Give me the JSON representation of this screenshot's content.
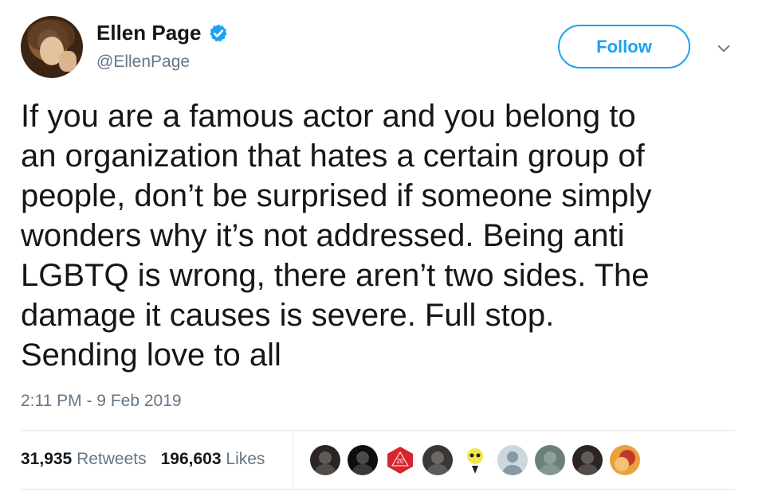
{
  "author": {
    "name": "Ellen Page",
    "handle": "@EllenPage",
    "verified": true
  },
  "actions": {
    "follow_label": "Follow"
  },
  "tweet": {
    "text": "If you are a famous actor and you belong to\nan organization that hates a certain group of\npeople, don’t be surprised if someone simply\nwonders why it’s not addressed. Being anti\nLGBTQ is wrong, there aren’t two sides. The\ndamage it causes is severe. Full stop.\nSending love to all",
    "timestamp": "2:11 PM - 9 Feb 2019"
  },
  "stats": {
    "retweets_count": "31,935",
    "retweets_label": "Retweets",
    "likes_count": "196,603",
    "likes_label": "Likes"
  },
  "likers": [
    {
      "icon": "avatar-woman-dark-hair",
      "color": "#2b2422"
    },
    {
      "icon": "avatar-dark-portrait",
      "color": "#0e0e0e"
    },
    {
      "icon": "avatar-red-d20-die",
      "color": "#d7262b",
      "label": "20"
    },
    {
      "icon": "avatar-night-scene",
      "color": "#3a3735"
    },
    {
      "icon": "avatar-cartoon-yellow",
      "color": "#f2e64b"
    },
    {
      "icon": "avatar-default-silhouette",
      "color": "#ccd6dd"
    },
    {
      "icon": "avatar-group-photo",
      "color": "#6a7f7a"
    },
    {
      "icon": "avatar-woman-portrait",
      "color": "#2d2523"
    },
    {
      "icon": "avatar-orange-portrait",
      "color": "#e9a13d"
    }
  ],
  "colors": {
    "accent": "#1da1f2",
    "text_primary": "#14171a",
    "text_secondary": "#657786",
    "divider": "#e1e8ed"
  }
}
